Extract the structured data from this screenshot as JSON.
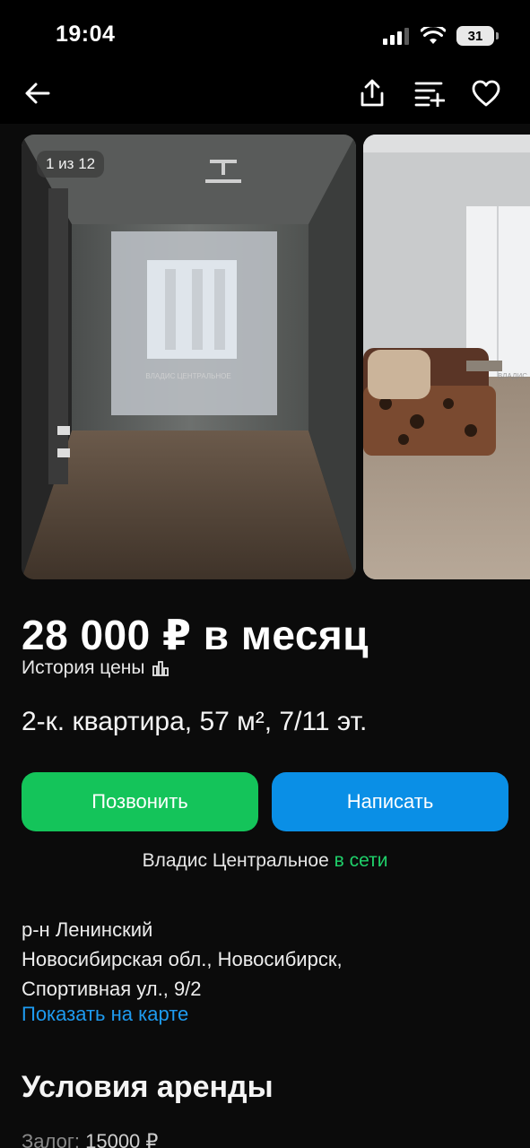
{
  "status_bar": {
    "time": "19:04",
    "battery": "31"
  },
  "nav": {
    "back_icon": "arrow-left-icon",
    "share_icon": "share-icon",
    "compare_icon": "compare-list-icon",
    "favorite_icon": "heart-icon"
  },
  "gallery": {
    "counter": "1 из 12",
    "watermark": "ВЛАДИС ЦЕНТРАЛЬНОЕ"
  },
  "listing": {
    "price": "28 000 ₽ в месяц",
    "price_history": "История цены",
    "title": "2-к. квартира, 57 м², 7/11 эт."
  },
  "actions": {
    "call": "Позвонить",
    "write": "Написать"
  },
  "seller": {
    "name": "Владис Центральное",
    "status": "в сети"
  },
  "address": {
    "district": "р-н Ленинский",
    "line1": "Новосибирская обл., Новосибирск,",
    "line2": "Спортивная ул., 9/2",
    "map_link": "Показать на карте"
  },
  "rent_conditions": {
    "title": "Условия аренды",
    "deposit_label": "Залог:",
    "deposit_value": "15000 ₽"
  },
  "colors": {
    "call_button": "#14c45a",
    "write_button": "#0a8fe6",
    "online": "#1fd06a",
    "link": "#1e9bf0"
  }
}
